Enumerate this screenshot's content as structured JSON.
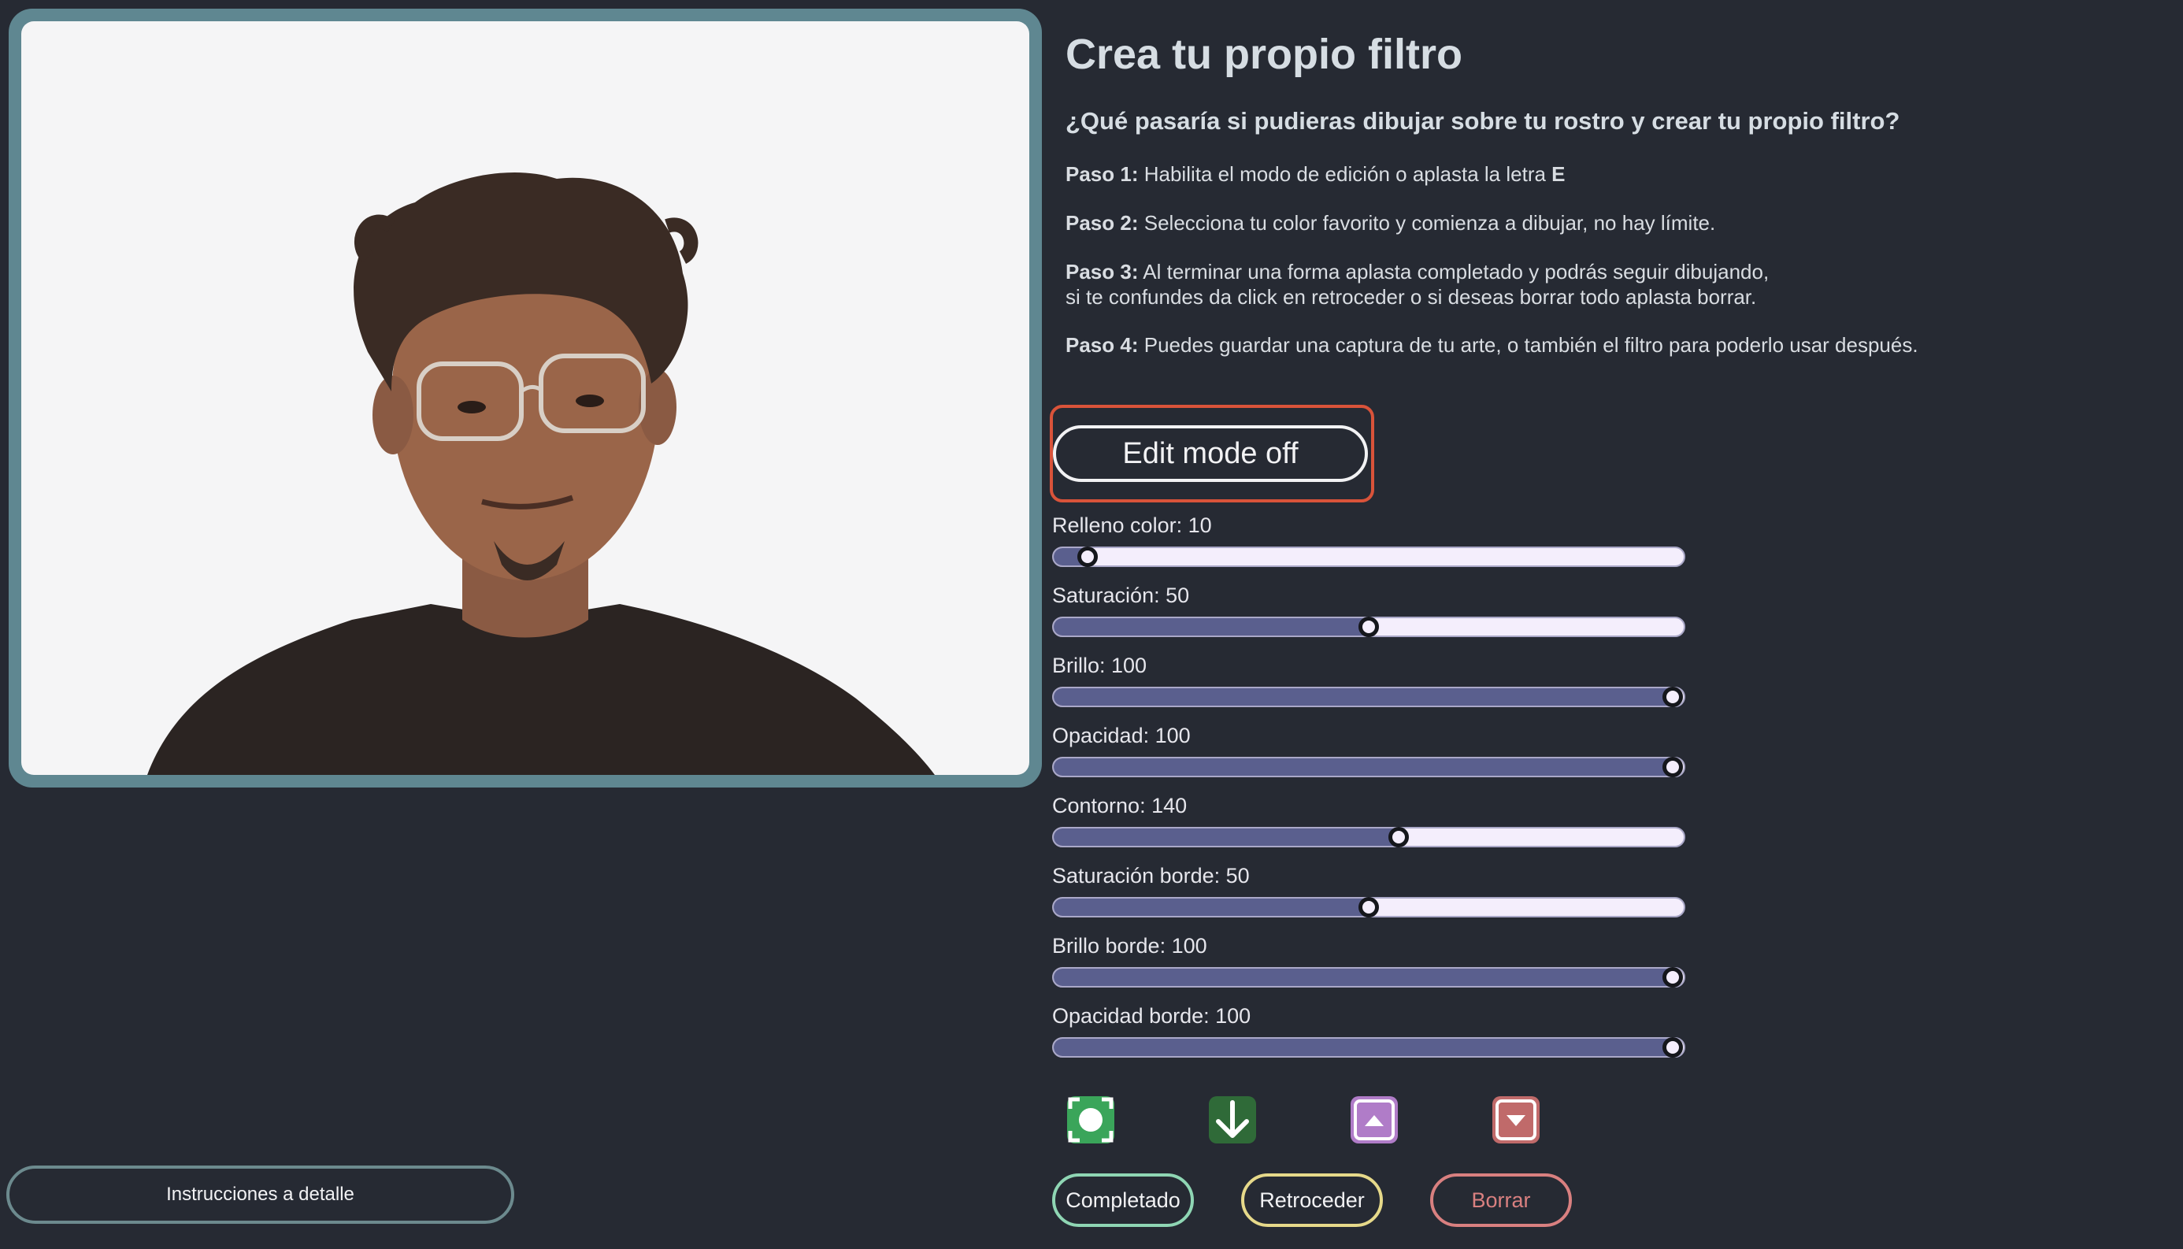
{
  "title": "Crea tu propio filtro",
  "subtitle": "¿Qué pasaría si pudieras dibujar sobre tu rostro y crear tu propio filtro?",
  "steps": [
    {
      "label": "Paso 1:",
      "text": "Habilita el modo de edición o aplasta la letra ",
      "key": "E"
    },
    {
      "label": "Paso 2:",
      "text": "Selecciona tu color favorito y comienza a dibujar, no hay límite."
    },
    {
      "label": "Paso 3:",
      "text": "Al terminar una forma aplasta completado y podrás seguir dibujando,",
      "text2": "si te confundes da click en retroceder o si deseas borrar todo aplasta borrar."
    },
    {
      "label": "Paso 4:",
      "text": "Puedes guardar una captura de tu arte, o también el filtro para poderlo usar después."
    }
  ],
  "edit_mode": {
    "label": "Edit mode off"
  },
  "sliders": [
    {
      "label": "Relleno color: 10",
      "fraction": 0.054
    },
    {
      "label": "Saturación: 50",
      "fraction": 0.5
    },
    {
      "label": "Brillo: 100",
      "fraction": 0.982
    },
    {
      "label": "Opacidad: 100",
      "fraction": 0.982
    },
    {
      "label": "Contorno: 140",
      "fraction": 0.548
    },
    {
      "label": "Saturación borde: 50",
      "fraction": 0.5
    },
    {
      "label": "Brillo borde: 100",
      "fraction": 0.982
    },
    {
      "label": "Opacidad borde: 100",
      "fraction": 0.982
    }
  ],
  "actions": [
    {
      "label": "Completado",
      "color": "#8fd6b4",
      "icon": "record-icon",
      "icon_bg": "#3aa55a"
    },
    {
      "label": "Retroceder",
      "color": "#e6d98a",
      "icon": "arrow-down-icon",
      "icon_bg": "#2f6a38"
    },
    {
      "label": "Borrar",
      "color": "#d98080",
      "icon": "triangle-up-icon",
      "icon_bg": "#b07cc8"
    },
    {
      "icon": "triangle-down-icon",
      "icon_bg": "#c06a6a"
    }
  ],
  "details_button": {
    "label": "Instrucciones a detalle"
  }
}
